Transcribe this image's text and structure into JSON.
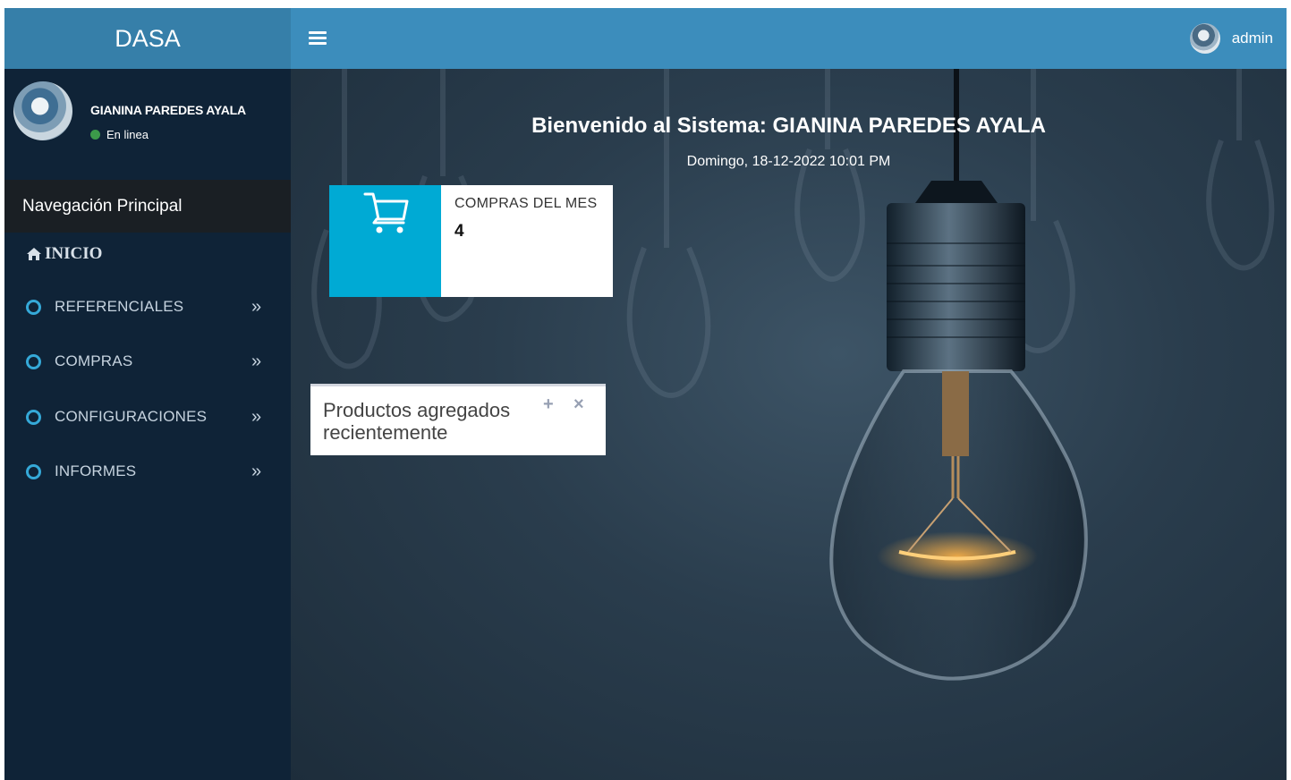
{
  "header": {
    "brand": "DASA",
    "user_name": "admin"
  },
  "sidebar": {
    "user_full_name": "GIANINA PAREDES AYALA",
    "user_status": "En linea",
    "nav_header": "Navegación Principal",
    "home_label": "INICIO",
    "items": [
      {
        "label": "REFERENCIALES",
        "chevron": "»"
      },
      {
        "label": "COMPRAS",
        "chevron": "»"
      },
      {
        "label": "CONFIGURACIONES",
        "chevron": "»"
      },
      {
        "label": "INFORMES",
        "chevron": "»"
      }
    ]
  },
  "main": {
    "welcome": "Bienvenido al Sistema: GIANINA PAREDES AYALA",
    "datetime": "Domingo, 18-12-2022 10:01 PM",
    "info_box": {
      "icon": "shopping-cart-icon",
      "label": "COMPRAS DEL MES",
      "value": "4"
    },
    "recent_box": {
      "title": "Productos agregados recientemente",
      "expand": "+",
      "close": "×"
    }
  },
  "colors": {
    "logo_bg": "#367fa9",
    "topbar_bg": "#3c8dbc",
    "sidebar_bg": "#0f2337",
    "nav_header_bg": "#1a1f24",
    "accent": "#00aad4",
    "status_online": "#3c9a4a"
  }
}
